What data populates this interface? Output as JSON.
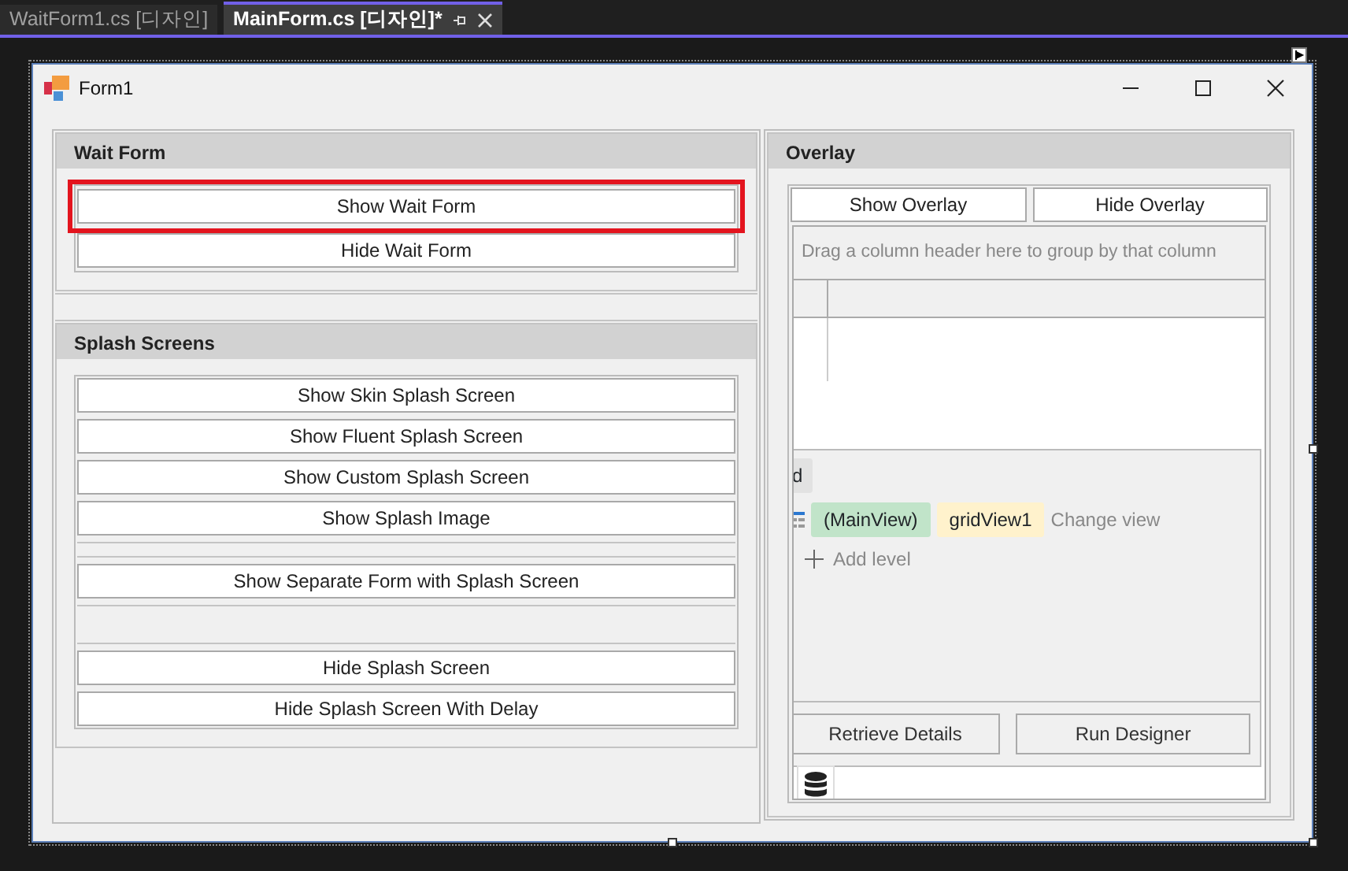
{
  "tabs": [
    {
      "label": "WaitForm1.cs [디자인]",
      "selected": false
    },
    {
      "label": "MainForm.cs [디자인]*",
      "selected": true
    }
  ],
  "window": {
    "title": "Form1"
  },
  "wait_form": {
    "title": "Wait Form",
    "buttons": [
      {
        "label": "Show Wait Form",
        "highlighted": true
      },
      {
        "label": "Hide Wait Form",
        "highlighted": false
      }
    ]
  },
  "splash_screens": {
    "title": "Splash Screens",
    "items": [
      {
        "kind": "button",
        "label": "Show Skin Splash Screen"
      },
      {
        "kind": "button",
        "label": "Show Fluent Splash Screen"
      },
      {
        "kind": "button",
        "label": "Show Custom Splash Screen"
      },
      {
        "kind": "button",
        "label": "Show Splash Image"
      },
      {
        "kind": "spacer"
      },
      {
        "kind": "button",
        "label": "Show Separate Form with Splash Screen"
      },
      {
        "kind": "spacer"
      },
      {
        "kind": "button",
        "label": "Hide Splash Screen"
      },
      {
        "kind": "button",
        "label": "Hide Splash Screen With Delay"
      }
    ]
  },
  "overlay": {
    "title": "Overlay",
    "buttons": [
      "Show Overlay",
      "Hide Overlay"
    ],
    "grid": {
      "group_panel_hint": "Drag a column header here to group by that column"
    },
    "level_designer": {
      "cut_chip": "d",
      "levels": [
        {
          "label": "(MainView)",
          "color": "#c1e4c9"
        },
        {
          "label": "gridView1",
          "color": "#fff2cc"
        }
      ],
      "change_view": "Change view",
      "add_level": "Add level",
      "buttons": [
        "Retrieve Details",
        "Run Designer"
      ]
    }
  }
}
